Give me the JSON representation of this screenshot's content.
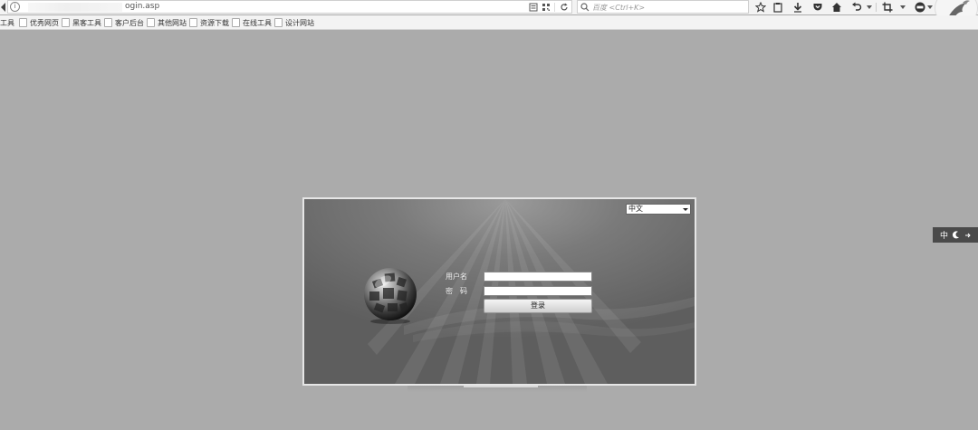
{
  "browser": {
    "url_text": "ogin.asp",
    "search_placeholder": "百度 <Ctrl+K>"
  },
  "bookmarks": [
    {
      "label": "工具"
    },
    {
      "label": "优秀网页"
    },
    {
      "label": "黑客工具"
    },
    {
      "label": "客户后台"
    },
    {
      "label": "其他网站"
    },
    {
      "label": "资源下载"
    },
    {
      "label": "在线工具"
    },
    {
      "label": "设计网站"
    }
  ],
  "login": {
    "language": "中文",
    "username_label": "用户名",
    "password_label": "密　码",
    "username_value": "",
    "password_value": "",
    "submit_label": "登录"
  },
  "ime": {
    "lang_char": "中"
  },
  "colors": {
    "page_bg": "#ababab",
    "panel_dark": "#5e5e5e",
    "panel_light": "#9a9a9a"
  }
}
